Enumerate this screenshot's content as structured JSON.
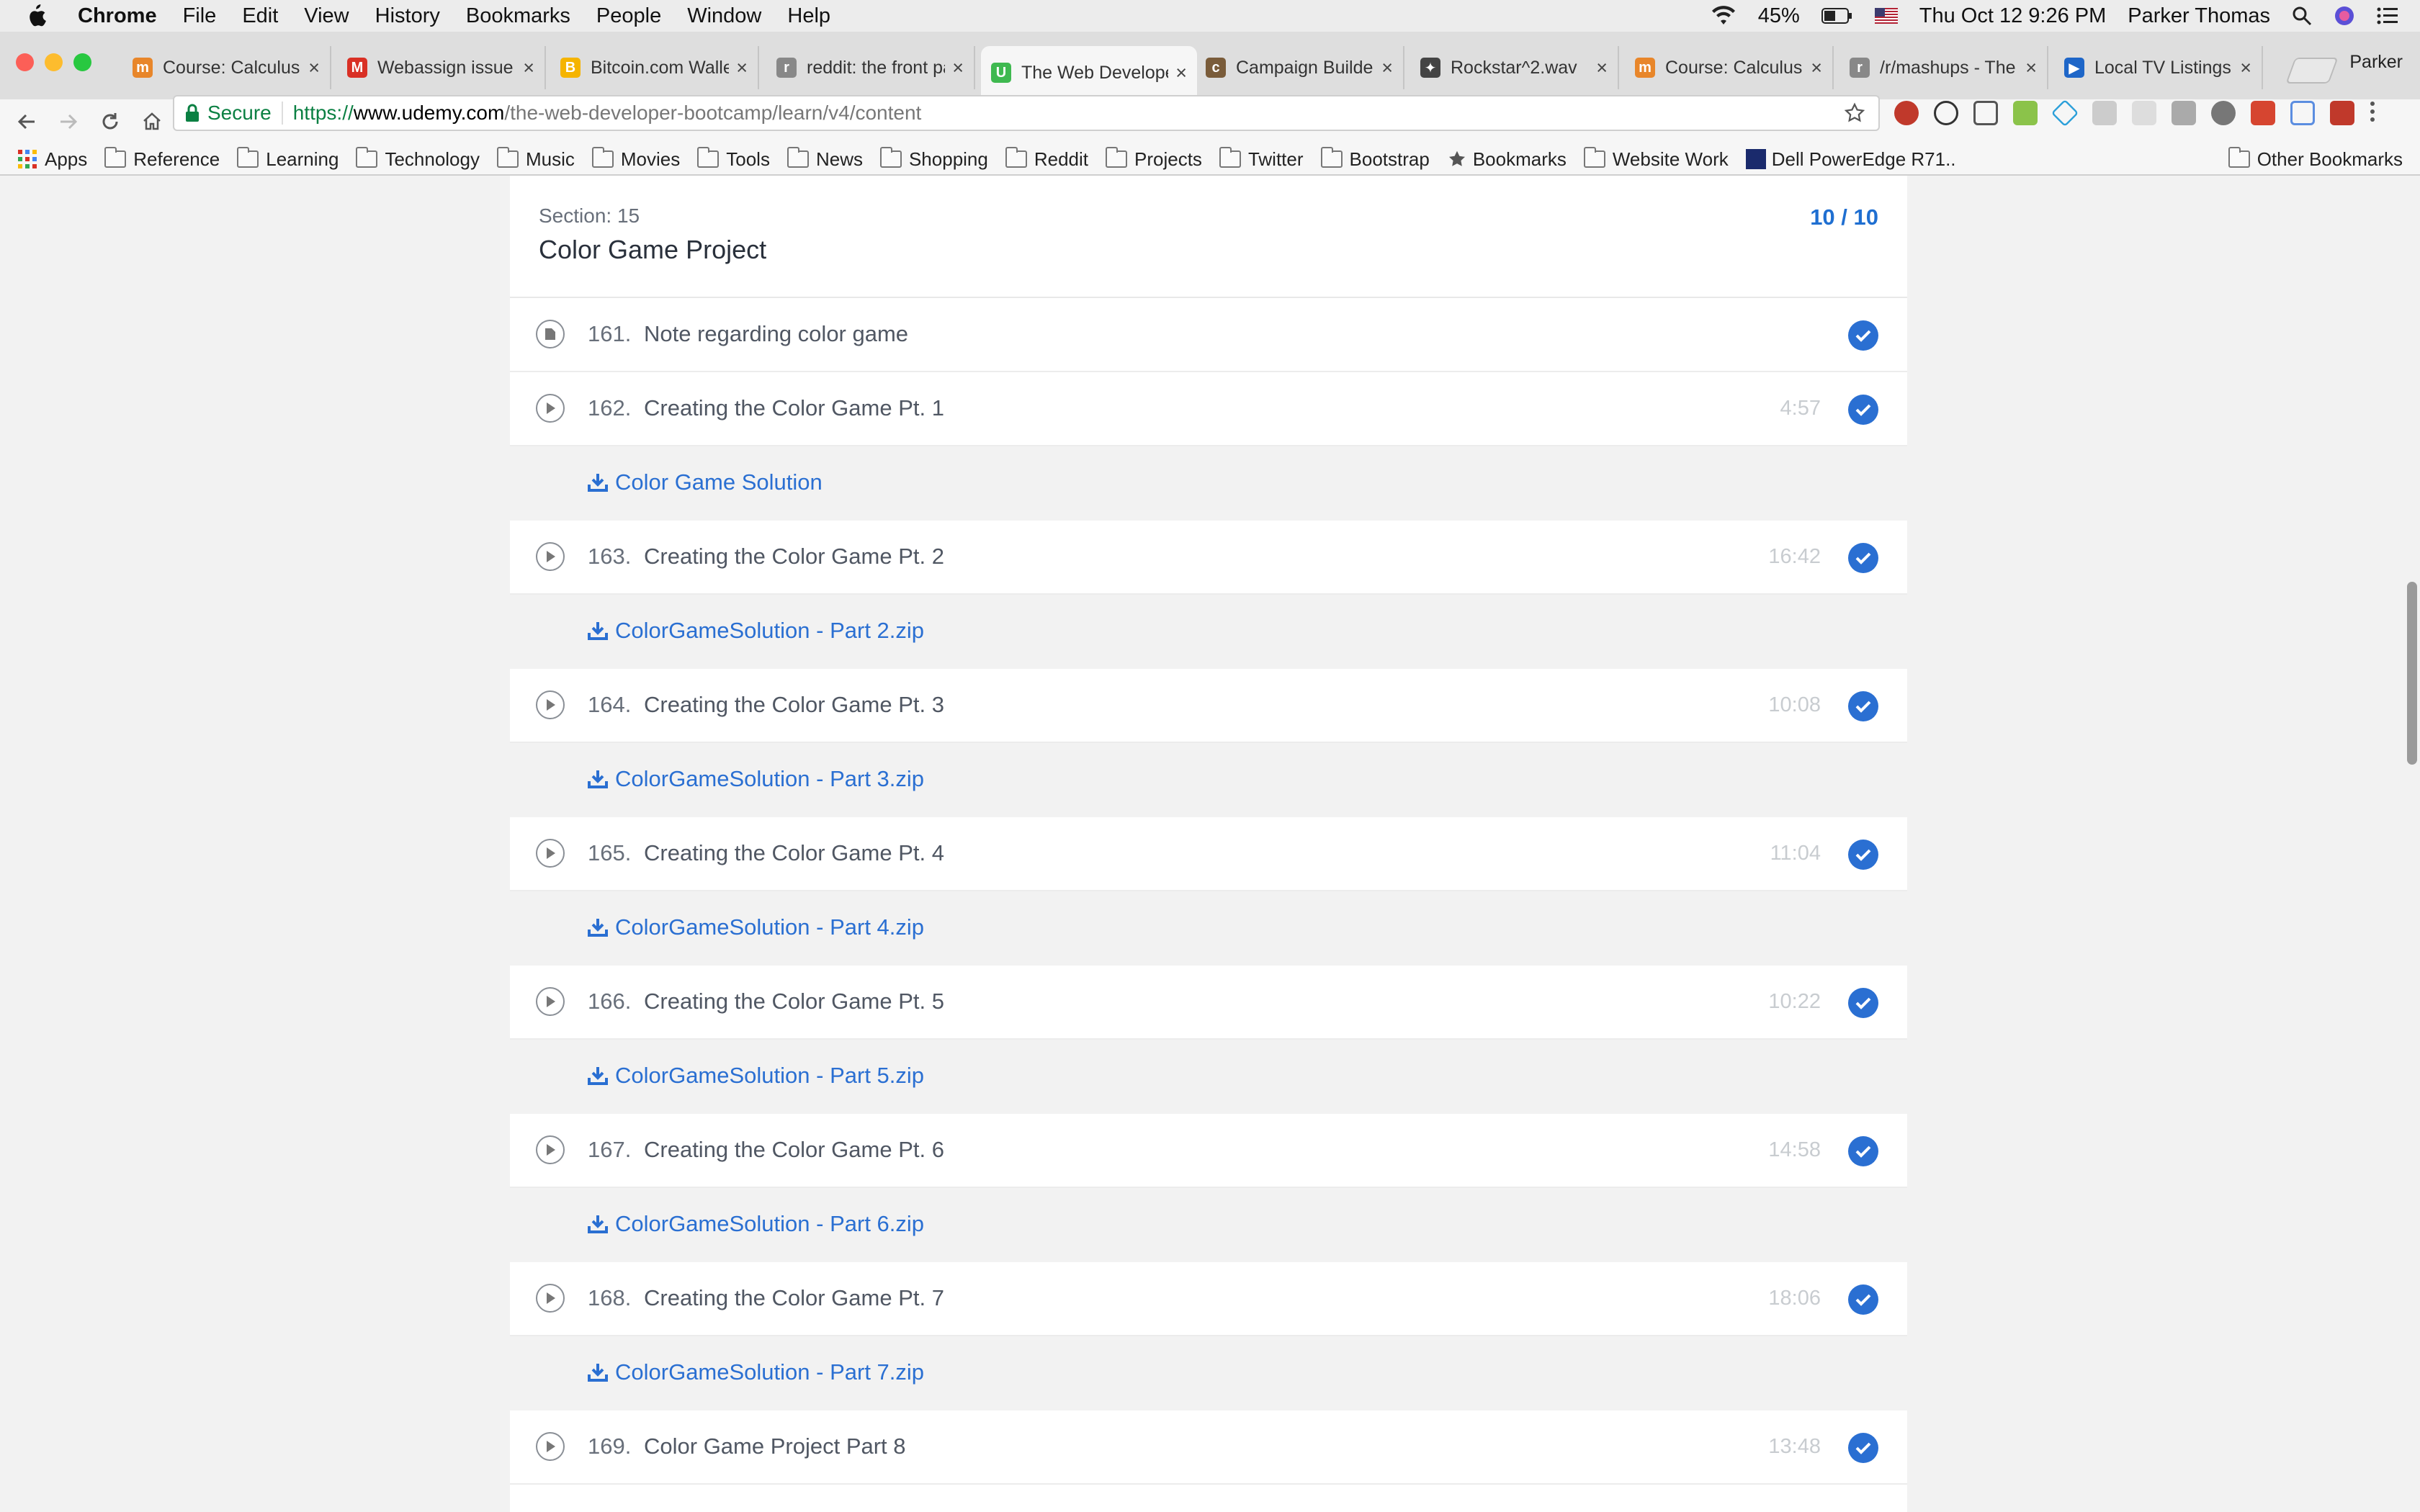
{
  "menubar": {
    "app": "Chrome",
    "items": [
      "File",
      "Edit",
      "View",
      "History",
      "Bookmarks",
      "People",
      "Window",
      "Help"
    ],
    "battery": "45%",
    "datetime": "Thu Oct 12  9:26 PM",
    "user": "Parker Thomas"
  },
  "tabs": [
    {
      "title": "Course: Calculus",
      "color": "#e8862a",
      "glyph": "m"
    },
    {
      "title": "Webassign issue",
      "color": "#d93025",
      "glyph": "M"
    },
    {
      "title": "Bitcoin.com Wallet",
      "color": "#f5b400",
      "glyph": "B"
    },
    {
      "title": "reddit: the front page",
      "color": "#888888",
      "glyph": "r"
    },
    {
      "title": "The Web Developer",
      "color": "#3fb950",
      "glyph": "U"
    },
    {
      "title": "Campaign Builder",
      "color": "#7a5c3a",
      "glyph": "c"
    },
    {
      "title": "Rockstar^2.wav",
      "color": "#444444",
      "glyph": "✦"
    },
    {
      "title": "Course: Calculus",
      "color": "#e8862a",
      "glyph": "m"
    },
    {
      "title": "/r/mashups - The",
      "color": "#888888",
      "glyph": "r"
    },
    {
      "title": "Local TV Listings",
      "color": "#1e66c8",
      "glyph": "▶"
    }
  ],
  "profile_name": "Parker",
  "address": {
    "secure_label": "Secure",
    "scheme": "https://",
    "host": "www.udemy.com",
    "path": "/the-web-developer-bootcamp/learn/v4/content"
  },
  "bookmarks": {
    "apps": "Apps",
    "folders": [
      "Reference",
      "Learning",
      "Technology",
      "Music",
      "Movies",
      "Tools",
      "News",
      "Shopping",
      "Reddit",
      "Projects",
      "Twitter",
      "Bootstrap"
    ],
    "star_item": "Bookmarks",
    "website_work": "Website Work",
    "dell": "Dell PowerEdge R71..",
    "other": "Other Bookmarks"
  },
  "section": {
    "number": "Section: 15",
    "title": "Color Game Project",
    "progress": "10 / 10"
  },
  "rows": [
    {
      "kind": "lecture",
      "icon": "doc",
      "num": "161.",
      "title": "Note regarding color game",
      "duration": ""
    },
    {
      "kind": "lecture",
      "icon": "play",
      "num": "162.",
      "title": "Creating the Color Game Pt. 1",
      "duration": "4:57"
    },
    {
      "kind": "resource",
      "title": "Color Game Solution"
    },
    {
      "kind": "lecture",
      "icon": "play",
      "num": "163.",
      "title": "Creating the Color Game Pt. 2",
      "duration": "16:42"
    },
    {
      "kind": "resource",
      "title": "ColorGameSolution - Part 2.zip"
    },
    {
      "kind": "lecture",
      "icon": "play",
      "num": "164.",
      "title": "Creating the Color Game Pt. 3",
      "duration": "10:08"
    },
    {
      "kind": "resource",
      "title": "ColorGameSolution - Part 3.zip"
    },
    {
      "kind": "lecture",
      "icon": "play",
      "num": "165.",
      "title": "Creating the Color Game Pt. 4",
      "duration": "11:04"
    },
    {
      "kind": "resource",
      "title": "ColorGameSolution - Part 4.zip"
    },
    {
      "kind": "lecture",
      "icon": "play",
      "num": "166.",
      "title": "Creating the Color Game Pt. 5",
      "duration": "10:22"
    },
    {
      "kind": "resource",
      "title": "ColorGameSolution - Part 5.zip"
    },
    {
      "kind": "lecture",
      "icon": "play",
      "num": "167.",
      "title": "Creating the Color Game Pt. 6",
      "duration": "14:58"
    },
    {
      "kind": "resource",
      "title": "ColorGameSolution - Part 6.zip"
    },
    {
      "kind": "lecture",
      "icon": "play",
      "num": "168.",
      "title": "Creating the Color Game Pt. 7",
      "duration": "18:06"
    },
    {
      "kind": "resource",
      "title": "ColorGameSolution - Part 7.zip"
    },
    {
      "kind": "lecture",
      "icon": "play",
      "num": "169.",
      "title": "Color Game Project Part 8",
      "duration": "13:48"
    }
  ]
}
